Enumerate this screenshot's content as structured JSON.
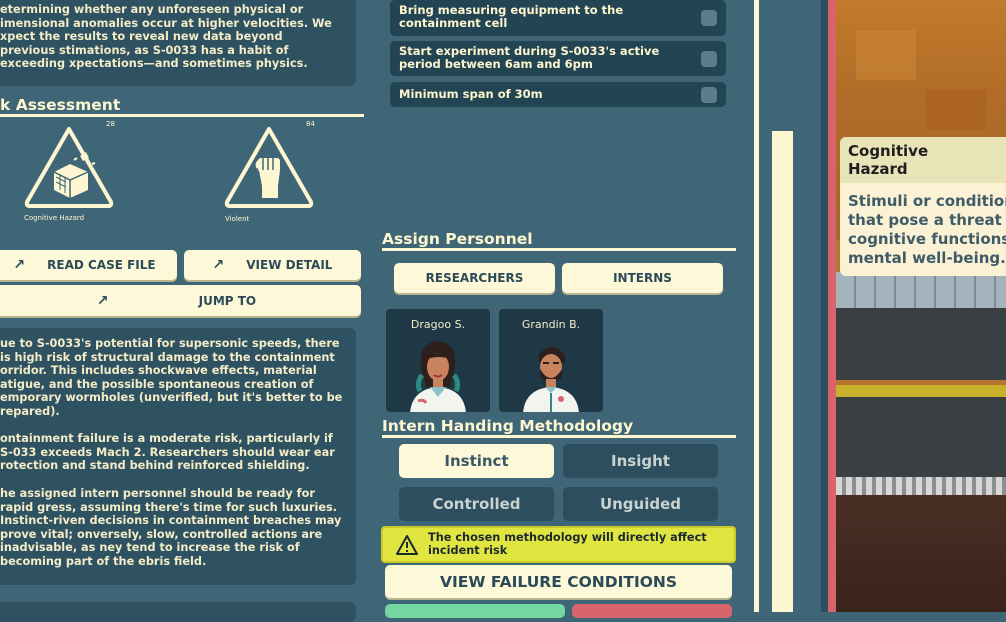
{
  "description_text": "etermining whether any unforeseen physical or imensional anomalies occur at higher velocities. We xpect the results to reveal new data beyond previous stimations, as S-0033 has a habit of exceeding xpectations—and sometimes physics.",
  "risk": {
    "title": "k Assessment",
    "items": [
      {
        "label": "Cognitive Hazard",
        "value": "28"
      },
      {
        "label": "Violent",
        "value": "84"
      }
    ]
  },
  "buttons": {
    "read_case_file": "READ CASE FILE",
    "view_detail": "VIEW DETAIL",
    "jump_to": "JUMP TO"
  },
  "notes": [
    "ue to S-0033's potential for supersonic speeds, there is high risk of structural damage to the containment orridor. This includes shockwave effects, material atigue, and the possible spontaneous creation of emporary wormholes (unverified, but it's better to be repared).",
    "ontainment failure is a moderate risk, particularly if S-033 exceeds Mach 2. Researchers should wear ear rotection and stand behind reinforced shielding.",
    "he assigned intern personnel should be ready for rapid gress, assuming there's time for such luxuries. Instinct-riven decisions in containment breaches may prove vital; onversely, slow, controlled actions are inadvisable, as ney tend to increase the risk of becoming part of the ebris field."
  ],
  "conditions": [
    {
      "text": "Bring measuring equipment to the containment cell",
      "checked": false
    },
    {
      "text": "Start experiment during S-0033's active period between 6am and 6pm",
      "checked": false
    },
    {
      "text": "Minimum span of 30m",
      "checked": false
    }
  ],
  "personnel": {
    "title": "Assign Personnel",
    "tabs": [
      "RESEARCHERS",
      "INTERNS"
    ],
    "people": [
      {
        "name": "Dragoo S."
      },
      {
        "name": "Grandin B."
      }
    ]
  },
  "methodology": {
    "title": "Intern Handing Methodology",
    "options": [
      {
        "label": "Instinct",
        "selected": true
      },
      {
        "label": "Insight",
        "selected": false
      },
      {
        "label": "Controlled",
        "selected": true
      },
      {
        "label": "Unguided",
        "selected": false
      }
    ],
    "warning": "The chosen methodology will directly affect incident risk",
    "failure_button": "VIEW FAILURE CONDITIONS"
  },
  "tooltip": {
    "title": "Cognitive Hazard",
    "body": "Stimuli or condition that pose a threat t cognitive functions mental well-being."
  },
  "colors": {
    "background": "#3e6677",
    "cream": "#fdf6d0",
    "warning_yellow": "#e1e53f",
    "accent_red": "#d9646b",
    "accent_green": "#74d6a0"
  }
}
